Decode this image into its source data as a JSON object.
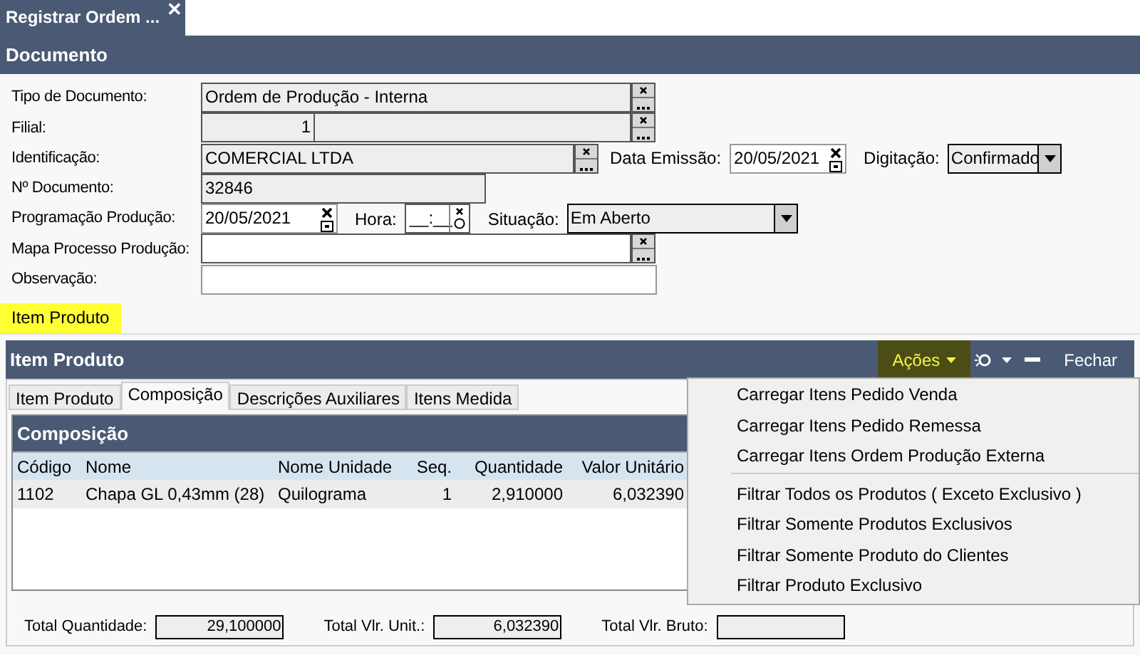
{
  "window_tab": {
    "title": "Registrar Ordem ...",
    "close": "✕"
  },
  "document": {
    "title": "Documento",
    "rows": [
      {
        "label": "Tipo de Documento:",
        "kind": "lookup",
        "value": "Ordem de Produção - Interna",
        "readonly": true
      },
      {
        "label": "Filial:",
        "kind": "split",
        "value": "1",
        "readonly": true
      },
      {
        "label": "Identificação:",
        "kind": "lookup",
        "value": "COMERCIAL LTDA",
        "readonly": true,
        "extras": [
          {
            "kind": "date",
            "label": "Data Emissão:",
            "value": "20/05/2021"
          },
          {
            "kind": "select",
            "label": "Digitação:",
            "value": "Confirmado"
          }
        ]
      },
      {
        "label": "Nº Documento:",
        "kind": "text",
        "value": "32846",
        "readonly": true
      },
      {
        "label": "Programação Produção:",
        "kind": "date",
        "value": "20/05/2021",
        "readonly": false,
        "extras": [
          {
            "kind": "time",
            "label": "Hora:",
            "value": "__:__"
          },
          {
            "kind": "select",
            "label": "Situação:",
            "value": "Em Aberto"
          }
        ]
      },
      {
        "label": "Mapa Processo Produção:",
        "kind": "lookup",
        "readonly": false
      },
      {
        "label": "Observação:",
        "kind": "text",
        "readonly": false
      }
    ]
  },
  "section_tabs": [
    {
      "label": "Item Produto",
      "selected": true
    }
  ],
  "item_panel": {
    "title": "Item Produto",
    "actions": "Ações",
    "close": "Fechar",
    "tabs": [
      {
        "label": "Item Produto",
        "selected": false
      },
      {
        "label": "Composição",
        "selected": true
      },
      {
        "label": "Descrições Auxiliares",
        "selected": false
      },
      {
        "label": "Itens Medida",
        "selected": false
      }
    ],
    "grid": {
      "title": "Composição",
      "columns": [
        "Código",
        "Nome",
        "Nome Unidade",
        "Seq.",
        "Quantidade",
        "Valor Unitário"
      ],
      "rows": [
        [
          "1102",
          "Chapa GL 0,43mm (28)",
          "Quilograma",
          "1",
          "2,910000",
          "6,032390"
        ]
      ]
    },
    "totals": [
      {
        "label": "Total Quantidade:",
        "value": "29,100000"
      },
      {
        "label": "Total Vlr. Unit.:",
        "value": "6,032390"
      },
      {
        "label": "Total Vlr. Bruto:"
      }
    ]
  },
  "actions_menu": {
    "groups": [
      [
        "Carregar Itens Pedido Venda",
        "Carregar Itens Pedido Remessa",
        "Carregar Itens Ordem Produção Externa"
      ],
      [
        "Filtrar Todos os Produtos ( Exceto Exclusivo )",
        "Filtrar Somente Produtos Exclusivos",
        "Filtrar Somente Produto do Clientes",
        "Filtrar Produto Exclusivo"
      ]
    ]
  }
}
